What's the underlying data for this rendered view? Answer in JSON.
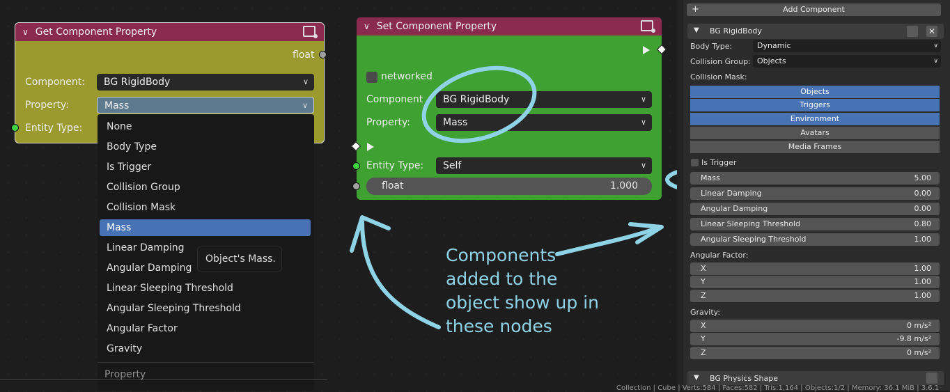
{
  "get_node": {
    "title": "Get Component Property",
    "output_label": "float",
    "component_label": "Component:",
    "component_value": "BG RigidBody",
    "property_label": "Property:",
    "property_value": "Mass",
    "entity_label": "Entity Type:"
  },
  "dropdown": {
    "items": [
      "None",
      "Body Type",
      "Is Trigger",
      "Collision Group",
      "Collision Mask",
      "Mass",
      "Linear Damping",
      "Angular Damping",
      "Linear Sleeping Threshold",
      "Angular Sleeping Threshold",
      "Angular Factor",
      "Gravity"
    ],
    "selected": "Mass",
    "footer": "Property",
    "tooltip": "Object's Mass."
  },
  "set_node": {
    "title": "Set Component Property",
    "networked_label": "networked",
    "component_label": "Component",
    "component_value": "BG RigidBody",
    "property_label": "Property:",
    "property_value": "Mass",
    "entity_label": "Entity Type:",
    "entity_value": "Self",
    "float_label": "float",
    "float_value": "1.000"
  },
  "annotation": {
    "lines": [
      "Components",
      "added to the",
      "object show up in",
      "these nodes"
    ]
  },
  "panel": {
    "add_component": "Add Component",
    "component_title": "BG RigidBody",
    "body_type_label": "Body Type:",
    "body_type_value": "Dynamic",
    "collision_group_label": "Collision Group:",
    "collision_group_value": "Objects",
    "collision_mask_label": "Collision Mask:",
    "mask_items": [
      {
        "label": "Objects",
        "on": true
      },
      {
        "label": "Triggers",
        "on": true
      },
      {
        "label": "Environment",
        "on": true
      },
      {
        "label": "Avatars",
        "on": false
      },
      {
        "label": "Media Frames",
        "on": false
      }
    ],
    "is_trigger_label": "Is Trigger",
    "fields": [
      {
        "label": "Mass",
        "value": "5.00"
      },
      {
        "label": "Linear Damping",
        "value": "0.00"
      },
      {
        "label": "Angular Damping",
        "value": "0.00"
      },
      {
        "label": "Linear Sleeping Threshold",
        "value": "0.80"
      },
      {
        "label": "Angular Sleeping Threshold",
        "value": "1.00"
      }
    ],
    "angular_factor_label": "Angular Factor:",
    "angular_factor": [
      {
        "label": "X",
        "value": "1.00"
      },
      {
        "label": "Y",
        "value": "1.00"
      },
      {
        "label": "Z",
        "value": "1.00"
      }
    ],
    "gravity_label": "Gravity:",
    "gravity": [
      {
        "label": "X",
        "value": "0 m/s²"
      },
      {
        "label": "Y",
        "value": "-9.8 m/s²"
      },
      {
        "label": "Z",
        "value": "0 m/s²"
      }
    ],
    "next_component": "BG Physics Shape"
  },
  "status_bar": "Collection | Cube | Verts:584 | Faces:582 | Tris:1,164 | Objects:1/2 | Memory: 36.1 MiB | 3.6.1",
  "colors": {
    "get_node_body": "#9a9a2e",
    "set_node_body": "#3ea131",
    "node_header": "#8a2a4c",
    "selection": "#4772b3",
    "annotation": "#8fd3e6"
  }
}
